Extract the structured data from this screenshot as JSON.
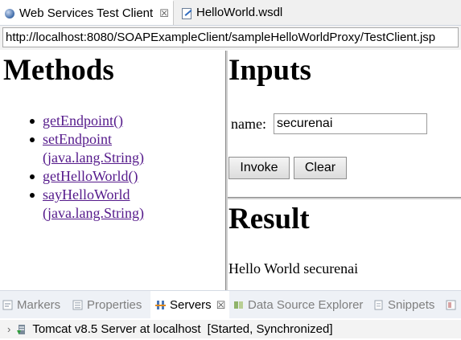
{
  "editor_tabs": [
    {
      "label": "Web Services Test Client",
      "icon": "globe-icon",
      "active": true
    },
    {
      "label": "HelloWorld.wsdl",
      "icon": "wsdl-file-icon",
      "active": false
    }
  ],
  "close_glyph": "☒",
  "address": {
    "value": "http://localhost:8080/SOAPExampleClient/sampleHelloWorldProxy/TestClient.jsp"
  },
  "methods": {
    "title": "Methods",
    "items": [
      {
        "line1": "getEndpoint()",
        "line2": ""
      },
      {
        "line1": "setEndpoint",
        "line2": "(java.lang.String)"
      },
      {
        "line1": "getHelloWorld()",
        "line2": ""
      },
      {
        "line1": "sayHelloWorld",
        "line2": "(java.lang.String)"
      }
    ]
  },
  "inputs": {
    "title": "Inputs",
    "name_label": "name:",
    "name_value": "securenai",
    "invoke_label": "Invoke",
    "clear_label": "Clear"
  },
  "result": {
    "title": "Result",
    "text": "Hello World securenai"
  },
  "view_tabs": [
    {
      "label": "Markers",
      "icon": "markers-icon",
      "active": false
    },
    {
      "label": "Properties",
      "icon": "properties-icon",
      "active": false
    },
    {
      "label": "Servers",
      "icon": "servers-icon",
      "active": true
    },
    {
      "label": "Data Source Explorer",
      "icon": "data-source-icon",
      "active": false
    },
    {
      "label": "Snippets",
      "icon": "snippets-icon",
      "active": false
    }
  ],
  "servers": [
    {
      "name": "Tomcat v8.5 Server at localhost",
      "status": "[Started, Synchronized]",
      "icon": "tomcat-server-icon"
    }
  ],
  "colors": {
    "link": "#551a8b",
    "accent": "#2f6bbf"
  }
}
